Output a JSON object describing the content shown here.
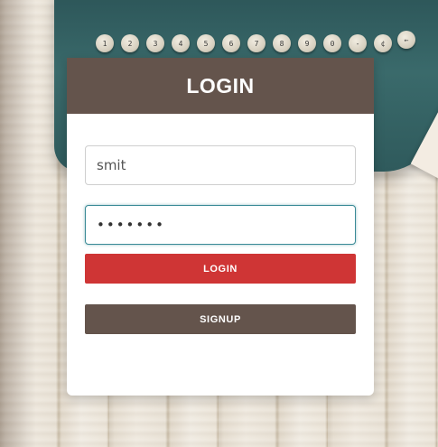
{
  "login_form": {
    "title": "LOGIN",
    "username_value": "smit",
    "password_value": "•••••••",
    "login_button": "LOGIN",
    "signup_button": "SIGNUP"
  },
  "colors": {
    "header": "#64544c",
    "login_button": "#cf3535",
    "signup_button": "#64544c",
    "focus_border": "#3a8a96"
  },
  "background": {
    "typewriter_keys": [
      "1",
      "2",
      "3",
      "4",
      "5",
      "6",
      "7",
      "8",
      "9",
      "0",
      "-",
      "¢",
      "←"
    ]
  }
}
